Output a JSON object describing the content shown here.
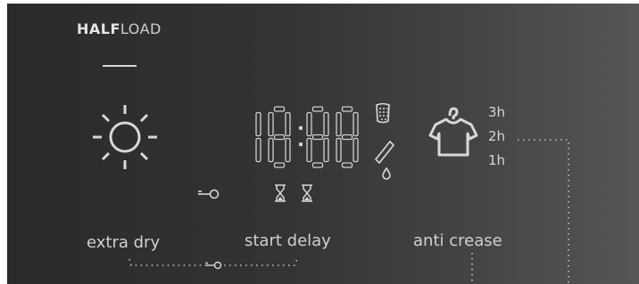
{
  "halfload": {
    "bold": "HALF",
    "light": "LOAD"
  },
  "display": {
    "digits": "18:88"
  },
  "labels": {
    "extra_dry": "extra dry",
    "start_delay": "start delay",
    "anti_crease": "anti crease"
  },
  "anti_crease_levels": [
    "3h",
    "2h",
    "1h"
  ],
  "icons": [
    "sun-icon",
    "key-lock-icon",
    "hourglass-icon",
    "drum-icon",
    "dosing-icon",
    "shirt-hanger-icon"
  ],
  "colors": {
    "panel_dark": "#2a2a2a",
    "panel_light": "#565656",
    "symbol": "#d8d8d8",
    "digit_off": "#d0d0d0"
  }
}
